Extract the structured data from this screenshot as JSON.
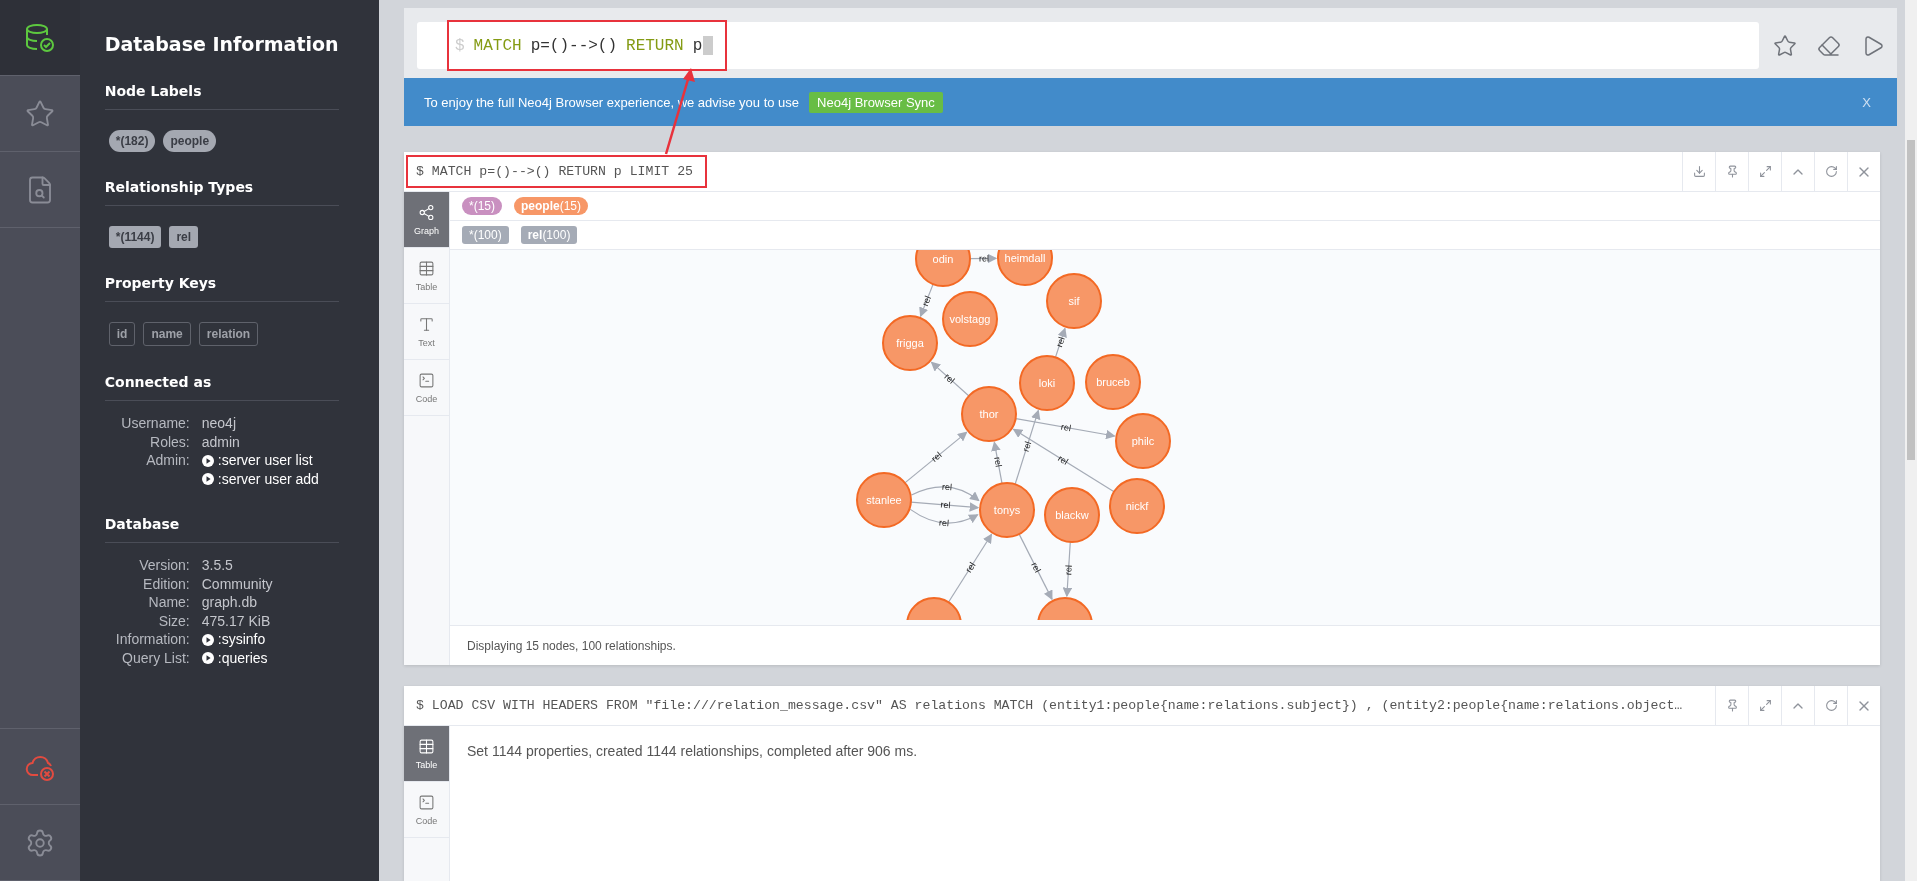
{
  "nav": {
    "items": [
      {
        "kind": "database",
        "selected": true
      },
      {
        "kind": "favorites",
        "selected": false
      },
      {
        "kind": "guides",
        "selected": false
      }
    ],
    "bottom_items": [
      {
        "kind": "sync-off"
      },
      {
        "kind": "settings"
      }
    ]
  },
  "sidebar": {
    "title": "Database Information",
    "node_labels": {
      "heading": "Node Labels",
      "items": [
        "*(182)",
        "people"
      ]
    },
    "relationship_types": {
      "heading": "Relationship Types",
      "items": [
        "*(1144)",
        "rel"
      ]
    },
    "property_keys": {
      "heading": "Property Keys",
      "items": [
        "id",
        "name",
        "relation"
      ]
    },
    "connected_as": {
      "heading": "Connected as",
      "rows": [
        {
          "label": "Username:",
          "value": "neo4j",
          "kind": "text"
        },
        {
          "label": "Roles:",
          "value": "admin",
          "kind": "text"
        },
        {
          "label": "Admin:",
          "value": ":server user list",
          "kind": "command"
        },
        {
          "value": ":server user add",
          "kind": "command"
        }
      ]
    },
    "database": {
      "heading": "Database",
      "rows": [
        {
          "label": "Version:",
          "value": "3.5.5",
          "kind": "text"
        },
        {
          "label": "Edition:",
          "value": "Community",
          "kind": "text"
        },
        {
          "label": "Name:",
          "value": "graph.db",
          "kind": "text"
        },
        {
          "label": "Size:",
          "value": "475.17 KiB",
          "kind": "text"
        },
        {
          "label": "Information:",
          "value": ":sysinfo",
          "kind": "command"
        },
        {
          "label": "Query List:",
          "value": ":queries",
          "kind": "command"
        }
      ]
    }
  },
  "editor": {
    "prompt": "$",
    "tokens": [
      {
        "text": "MATCH",
        "kind": "keyword"
      },
      {
        "text": "p=()-->()",
        "kind": "plain"
      },
      {
        "text": "RETURN",
        "kind": "keyword"
      },
      {
        "text": "p",
        "kind": "plain"
      }
    ],
    "highlighted": true
  },
  "banner": {
    "text": "To enjoy the full Neo4j Browser experience, we advise you to use",
    "button": "Neo4j Browser Sync",
    "close": "X"
  },
  "frames": [
    {
      "query": "$ MATCH p=()-->() RETURN p LIMIT 25",
      "highlighted": true,
      "can_download": true,
      "tabs": [
        {
          "label": "Graph",
          "kind": "graph",
          "selected": true
        },
        {
          "label": "Table",
          "kind": "table",
          "selected": false
        },
        {
          "label": "Text",
          "kind": "text",
          "selected": false
        },
        {
          "label": "Code",
          "kind": "code",
          "selected": false
        }
      ],
      "legend": {
        "labels": [
          {
            "text": "*(15)",
            "color": "#c990c0"
          },
          {
            "text": "**people**(15)",
            "color": "#f79767"
          }
        ],
        "relationships": [
          {
            "text": "*(100)"
          },
          {
            "text": "**rel**(100)"
          }
        ]
      },
      "graph": {
        "nodes": [
          "odin",
          "heimdall",
          "sif",
          "volstagg",
          "frigga",
          "loki",
          "bruceb",
          "thor",
          "philc",
          "stanlee",
          "tonys",
          "blackw",
          "nickf"
        ],
        "edge_labels": [
          "rel",
          "rel",
          "rel",
          "rel",
          "rel",
          "rel",
          "rel",
          "rel",
          "rel",
          "rel",
          "rel",
          "rel",
          "rel",
          "rel",
          "rel"
        ]
      },
      "status": "Displaying 15 nodes, 100 relationships."
    },
    {
      "query": "$ LOAD CSV WITH HEADERS FROM \"file:///relation_message.csv\" AS relations MATCH (entity1:people{name:relations.subject}) , (entity2:people{name:relations.object…",
      "highlighted": false,
      "can_download": false,
      "tabs": [
        {
          "label": "Table",
          "kind": "table",
          "selected": true
        },
        {
          "label": "Code",
          "kind": "code",
          "selected": false
        }
      ],
      "message": "Set 1144 properties, created 1144 relationships, completed after 906 ms."
    }
  ]
}
